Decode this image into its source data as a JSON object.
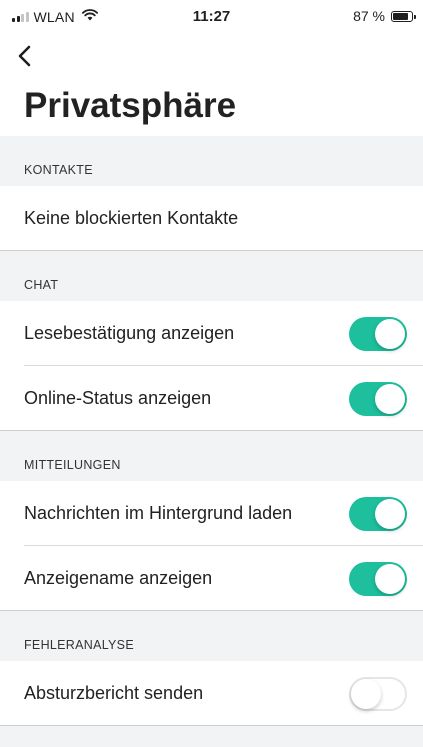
{
  "status_bar": {
    "carrier": "WLAN",
    "time": "11:27",
    "battery_text": "87 %",
    "battery_level": 0.87
  },
  "nav": {
    "back_icon": "chevron-left-icon",
    "title": "Privatsphäre"
  },
  "sections": {
    "kontakte": {
      "header": "KONTAKTE",
      "items": [
        {
          "label": "Keine blockierten Kontakte"
        }
      ]
    },
    "chat": {
      "header": "CHAT",
      "items": [
        {
          "label": "Lesebestätigung anzeigen",
          "enabled": true
        },
        {
          "label": "Online-Status anzeigen",
          "enabled": true
        }
      ]
    },
    "mitteilungen": {
      "header": "MITTEILUNGEN",
      "items": [
        {
          "label": "Nachrichten im Hintergrund laden",
          "enabled": true
        },
        {
          "label": "Anzeigename anzeigen",
          "enabled": true
        }
      ]
    },
    "fehleranalyse": {
      "header": "FEHLERANALYSE",
      "items": [
        {
          "label": "Absturzbericht senden",
          "enabled": false
        }
      ]
    }
  },
  "colors": {
    "toggle_on": "#1dbf9d",
    "section_bg": "#f2f3f5"
  }
}
